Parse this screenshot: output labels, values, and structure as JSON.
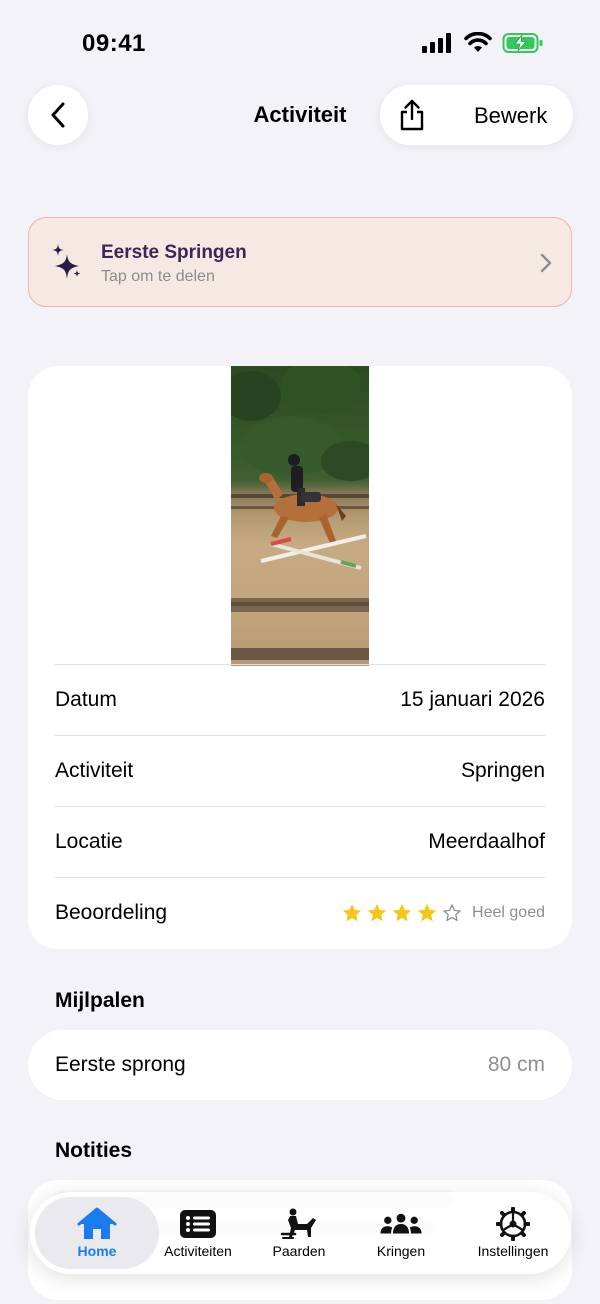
{
  "status_bar": {
    "time": "09:41"
  },
  "nav": {
    "title": "Activiteit",
    "edit_label": "Bewerk"
  },
  "banner": {
    "title": "Eerste Springen",
    "subtitle": "Tap om te delen"
  },
  "details": {
    "rows": [
      {
        "label": "Datum",
        "value": "15 januari 2026"
      },
      {
        "label": "Activiteit",
        "value": "Springen"
      },
      {
        "label": "Locatie",
        "value": "Meerdaalhof"
      }
    ],
    "rating": {
      "label": "Beoordeling",
      "stars_filled": 4,
      "stars_total": 5,
      "text": "Heel goed"
    }
  },
  "milestones": {
    "title": "Mijlpalen",
    "items": [
      {
        "name": "Eerste sprong",
        "value": "80 cm"
      }
    ]
  },
  "notes": {
    "title": "Notities"
  },
  "tabbar": {
    "tabs": [
      {
        "label": "Home",
        "icon": "house-icon",
        "active": true
      },
      {
        "label": "Activiteiten",
        "icon": "list-icon"
      },
      {
        "label": "Paarden",
        "icon": "horse-rider-icon"
      },
      {
        "label": "Kringen",
        "icon": "people-icon"
      },
      {
        "label": "Instellingen",
        "icon": "gear-icon"
      }
    ]
  },
  "colors": {
    "accent": "#1a7cf0",
    "banner_bg": "#f6e9e3",
    "banner_title": "#3b2657",
    "star": "#f5c518"
  }
}
